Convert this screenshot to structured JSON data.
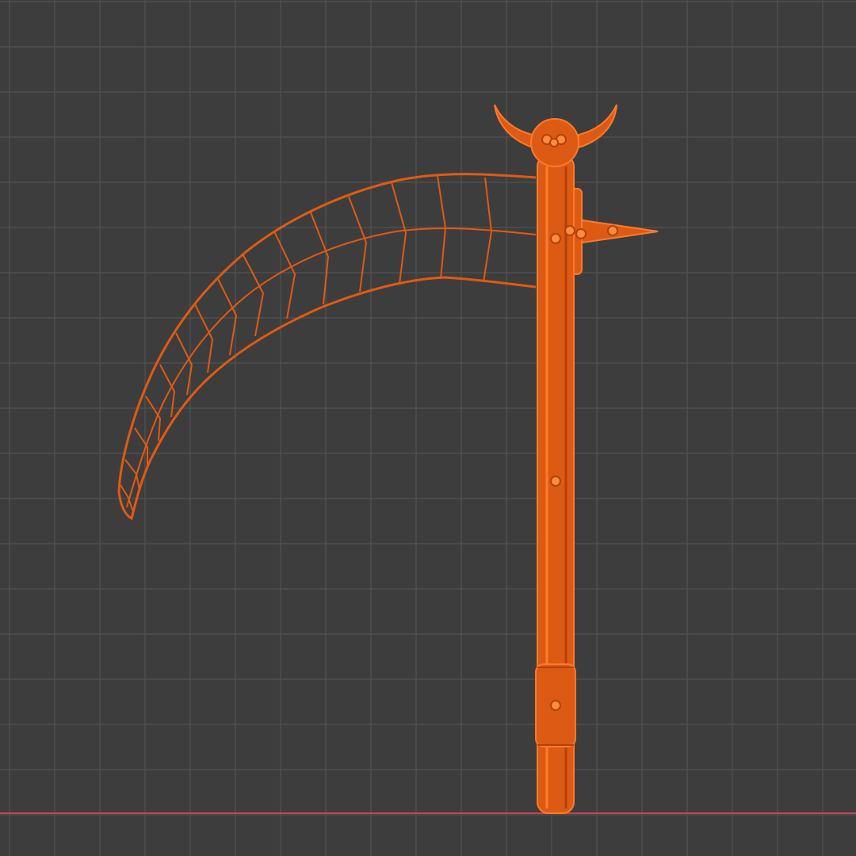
{
  "viewport": {
    "background_color": "#3d3d3d",
    "grid": {
      "visible": true,
      "line_color": "#4f4f4f",
      "major_line_color": "#555555"
    },
    "x_axis": {
      "visible": true,
      "color": "#c2474f"
    }
  },
  "scene_object": {
    "type": "scythe",
    "selected": true,
    "colors": {
      "wire": "#e15a12",
      "wire_bright": "#ff7a2a",
      "wire_dark": "#b2410a",
      "solid": "#dd5a14",
      "vertex": "#ff8c3c"
    }
  }
}
